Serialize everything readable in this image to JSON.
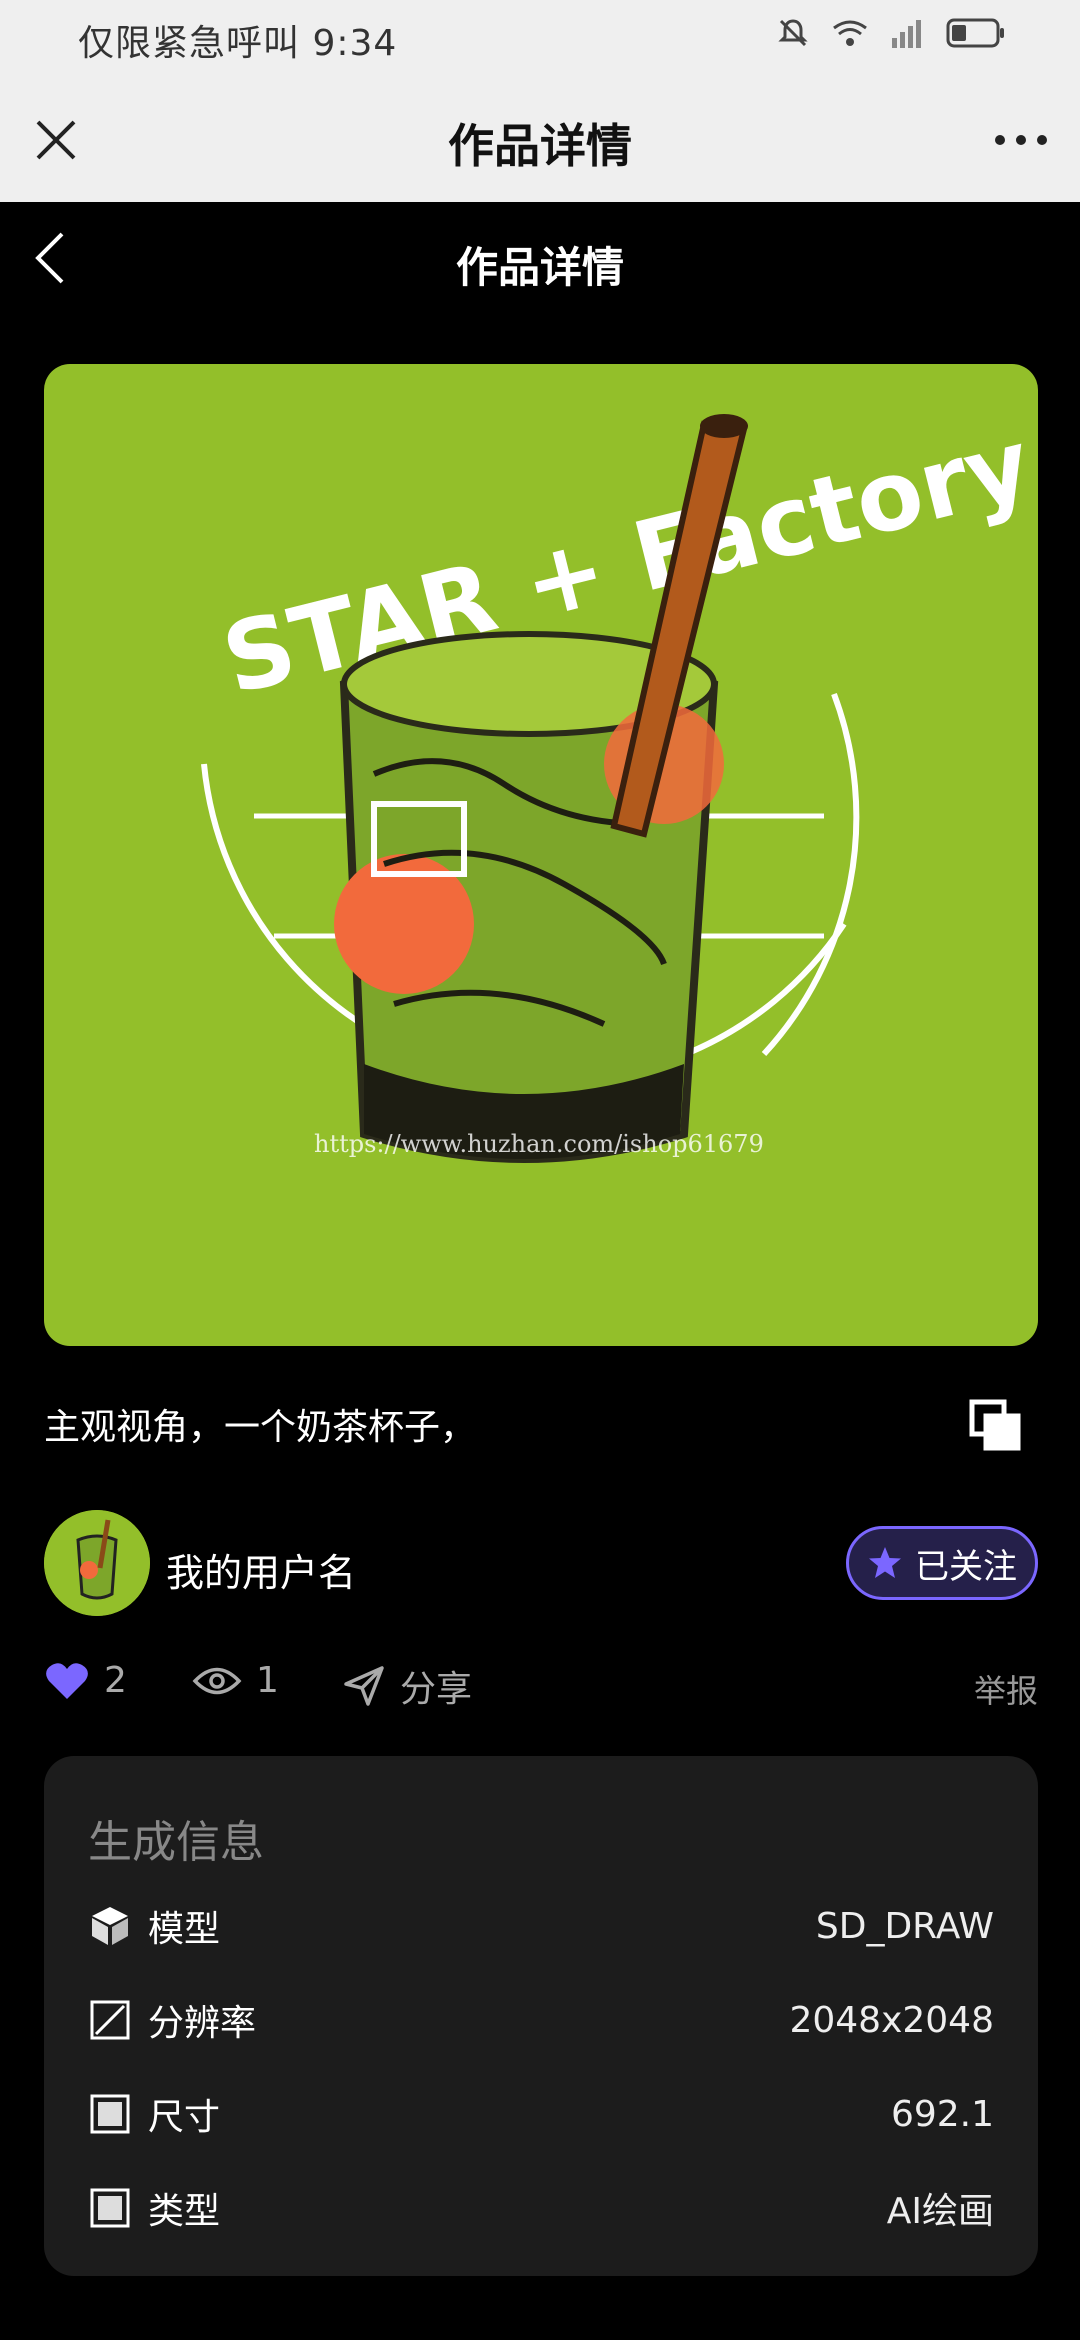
{
  "status_bar": {
    "left_text": "仅限紧急呼叫 9:34"
  },
  "top_header": {
    "title": "作品详情"
  },
  "page_header": {
    "title": "作品详情"
  },
  "artwork": {
    "title_text": "STAR + Factory",
    "watermark": "https://www.huzhan.com/ishop61679"
  },
  "prompt": "主观视角，一个奶茶杯子，",
  "user": {
    "name": "我的用户名",
    "follow_label": "已关注"
  },
  "actions": {
    "likes": "2",
    "views": "1",
    "share_label": "分享",
    "report_label": "举报"
  },
  "generation_info": {
    "title": "生成信息",
    "rows": [
      {
        "icon": "cube-icon",
        "label": "模型",
        "value": "SD_DRAW"
      },
      {
        "icon": "resolution-icon",
        "label": "分辨率",
        "value": "2048x2048"
      },
      {
        "icon": "square-icon",
        "label": "尺寸",
        "value": "692.1"
      },
      {
        "icon": "square-icon",
        "label": "类型",
        "value": "AI绘画"
      }
    ]
  },
  "colors": {
    "accent": "#7b67ff",
    "art_bg": "#93bf2a",
    "card_bg": "#1c1c1c"
  }
}
